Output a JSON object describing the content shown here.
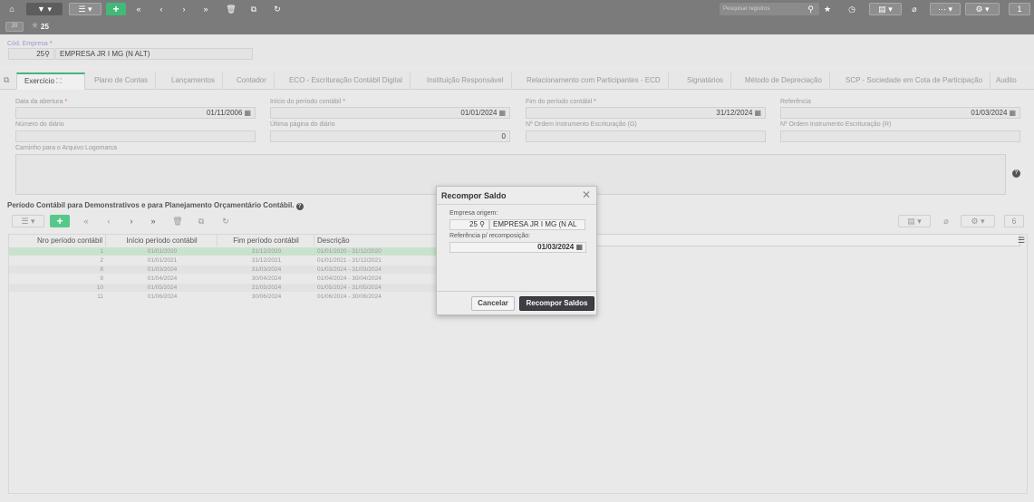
{
  "toolbar": {
    "search_placeholder": "Pesquisar registros",
    "page_counter": "1"
  },
  "record": {
    "badge": "20",
    "number": "25"
  },
  "empresa": {
    "label": "Cód. Empresa",
    "required_mark": "*",
    "code": "25",
    "name": "EMPRESA JR I MG (N ALT)"
  },
  "tabs": [
    {
      "label": "Exercício"
    },
    {
      "label": "Plano de Contas"
    },
    {
      "label": "Lançamentos"
    },
    {
      "label": "Contador"
    },
    {
      "label": "ECO - Escrituração Contábil Digital"
    },
    {
      "label": "Instituição Responsável"
    },
    {
      "label": "Relacionamento com Participantes - ECD"
    },
    {
      "label": "Signatários"
    },
    {
      "label": "Método de Depreciação"
    },
    {
      "label": "SCP - Sociedade em Cota de Participação"
    },
    {
      "label": "Audito"
    }
  ],
  "form": {
    "data_abertura_label": "Data da abertura",
    "data_abertura": "01/11/2006",
    "inicio_periodo_label": "Início do período contábil",
    "inicio_periodo": "01/01/2024",
    "fim_periodo_label": "Fim do período contábil",
    "fim_periodo": "31/12/2024",
    "referencia_label": "Referência",
    "referencia": "01/03/2024",
    "numero_diario_label": "Número do diário",
    "numero_diario": "",
    "ultima_pagina_label": "Última página do diário",
    "ultima_pagina": "0",
    "ordem_g_label": "Nº Ordem Instrumento Escrituração (G)",
    "ordem_r_label": "Nº Ordem Instrumento Escrituração (R)",
    "caminho_label": "Caminho para o Arquivo Logomarca",
    "required_mark": "*"
  },
  "grid": {
    "title": "Período Contábil para Demonstrativos e para Planejamento Orçamentário Contábil.",
    "page_size": "6",
    "columns": [
      "Nro período contábil",
      "Início período contábil",
      "Fim período contábil",
      "Descrição"
    ],
    "rows": [
      {
        "nro": "1",
        "inicio": "01/01/2020",
        "fim": "31/12/2020",
        "descricao": "01/01/2020 - 31/12/2020"
      },
      {
        "nro": "2",
        "inicio": "01/01/2021",
        "fim": "31/12/2021",
        "descricao": "01/01/2021 - 31/12/2021"
      },
      {
        "nro": "8",
        "inicio": "01/03/2024",
        "fim": "31/03/2024",
        "descricao": "01/03/2024 - 31/03/2024"
      },
      {
        "nro": "9",
        "inicio": "01/04/2024",
        "fim": "30/04/2024",
        "descricao": "01/04/2024 - 30/04/2024"
      },
      {
        "nro": "10",
        "inicio": "01/05/2024",
        "fim": "31/05/2024",
        "descricao": "01/05/2024 - 31/05/2024"
      },
      {
        "nro": "11",
        "inicio": "01/06/2024",
        "fim": "30/06/2024",
        "descricao": "01/06/2024 - 30/06/2024"
      }
    ]
  },
  "modal": {
    "title": "Recompor Saldo",
    "empresa_label": "Empresa origem:",
    "empresa_code": "25",
    "empresa_name": "EMPRESA JR I MG (N AL",
    "referencia_label": "Referência p/ recomposição:",
    "referencia": "01/03/2024",
    "cancel_label": "Cancelar",
    "ok_label": "Recompor Saldos"
  },
  "colors": {
    "accent": "#47b47a",
    "toolbar": "#7b7b7b",
    "selected_row": "#c9e2cd"
  }
}
